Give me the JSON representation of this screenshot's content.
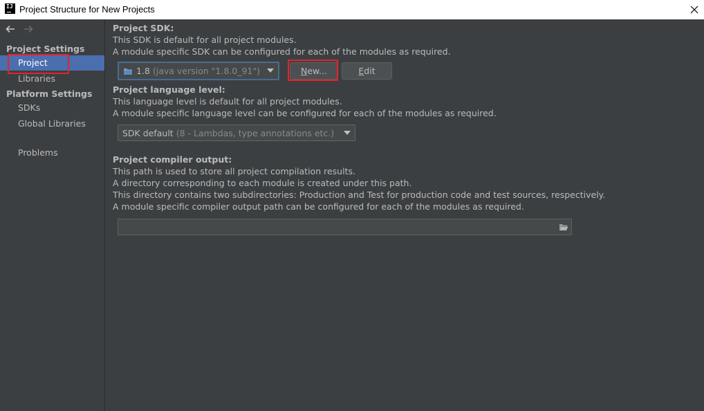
{
  "window": {
    "title": "Project Structure for New Projects",
    "app_icon_text": "IJ"
  },
  "sidebar": {
    "section_project_settings": "Project Settings",
    "section_platform_settings": "Platform Settings",
    "items": [
      {
        "label": "Project",
        "selected": true
      },
      {
        "label": "Libraries"
      },
      {
        "label": "SDKs"
      },
      {
        "label": "Global Libraries"
      },
      {
        "label": "Problems"
      }
    ]
  },
  "sdk": {
    "heading": "Project SDK:",
    "desc1": "This SDK is default for all project modules.",
    "desc2": "A module specific SDK can be configured for each of the modules as required.",
    "selected_version": "1.8",
    "selected_detail": "(java version \"1.8.0_91\")",
    "new_button_underlined": "N",
    "new_button_rest": "ew...",
    "edit_button_underlined": "E",
    "edit_button_rest": "dit"
  },
  "language": {
    "heading": "Project language level:",
    "desc1": "This language level is default for all project modules.",
    "desc2": "A module specific language level can be configured for each of the modules as required.",
    "selected_main": "SDK default",
    "selected_detail": "(8 - Lambdas, type annotations etc.)"
  },
  "compiler": {
    "heading": "Project compiler output:",
    "desc1": "This path is used to store all project compilation results.",
    "desc2": "A directory corresponding to each module is created under this path.",
    "desc3": "This directory contains two subdirectories: Production and Test for production code and test sources, respectively.",
    "desc4": "A module specific compiler output path can be configured for each of the modules as required.",
    "path_value": ""
  },
  "colors": {
    "background": "#3c3f41",
    "selection": "#4b6eaf",
    "highlight": "#e8222a"
  }
}
